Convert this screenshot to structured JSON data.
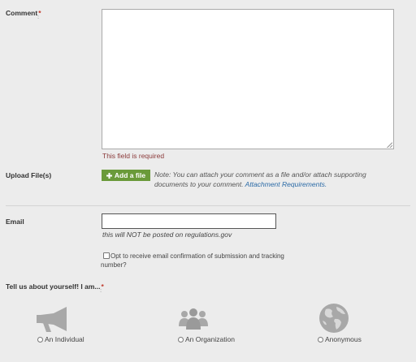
{
  "comment": {
    "label": "Comment",
    "required_marker": "*",
    "error": "This field is required"
  },
  "upload": {
    "label": "Upload File(s)",
    "button_label": "Add a file",
    "button_icon": "plus-icon",
    "note_text": "Note: You can attach your comment as a file and/or attach supporting documents to your comment.",
    "note_link": "Attachment Requirements."
  },
  "email": {
    "label": "Email",
    "value": "",
    "note": "this will NOT be posted on regulations.gov",
    "opt_in_label": "Opt to receive email confirmation of submission and tracking number?"
  },
  "about": {
    "label": "Tell us about yourself! I am...",
    "required_marker": "*",
    "choices": [
      {
        "label": "An Individual",
        "icon": "megaphone-icon"
      },
      {
        "label": "An Organization",
        "icon": "group-icon"
      },
      {
        "label": "Anonymous",
        "icon": "globe-icon"
      }
    ]
  },
  "colors": {
    "background": "#ececec",
    "button": "#6a9a3a",
    "error": "#8b3a3a",
    "link": "#2a6aa6",
    "required": "#c0392b"
  }
}
